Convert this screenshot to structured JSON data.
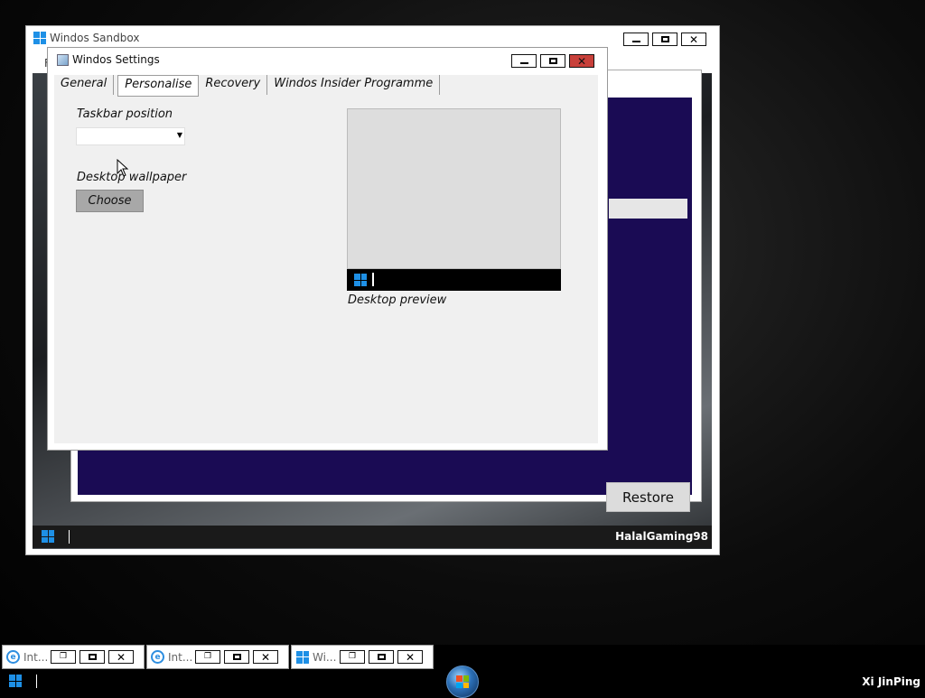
{
  "sandbox": {
    "title": "Windos Sandbox",
    "menu_letter": "F",
    "user": "HalalGaming98"
  },
  "back_window": {
    "restore_label": "Restore"
  },
  "settings": {
    "title": "Windos Settings",
    "tabs": [
      "General",
      "Personalise",
      "Recovery",
      "Windos Insider Programme"
    ],
    "active_tab": "Personalise",
    "taskbar_position_label": "Taskbar position",
    "taskbar_position_value": "",
    "wallpaper_label": "Desktop wallpaper",
    "choose_label": "Choose",
    "preview_label": "Desktop preview"
  },
  "taskbar": {
    "items": [
      {
        "label": "Int...",
        "icon": "ie-icon"
      },
      {
        "label": "Int...",
        "icon": "ie-icon"
      },
      {
        "label": "Wi...",
        "icon": "windows-icon"
      }
    ],
    "user": "Xi JinPing"
  },
  "colors": {
    "accent_blue": "#1e90e6",
    "close_red": "#c8403a",
    "sandbox_content": "#1a0b54",
    "choose_button": "#a8a8a8"
  }
}
